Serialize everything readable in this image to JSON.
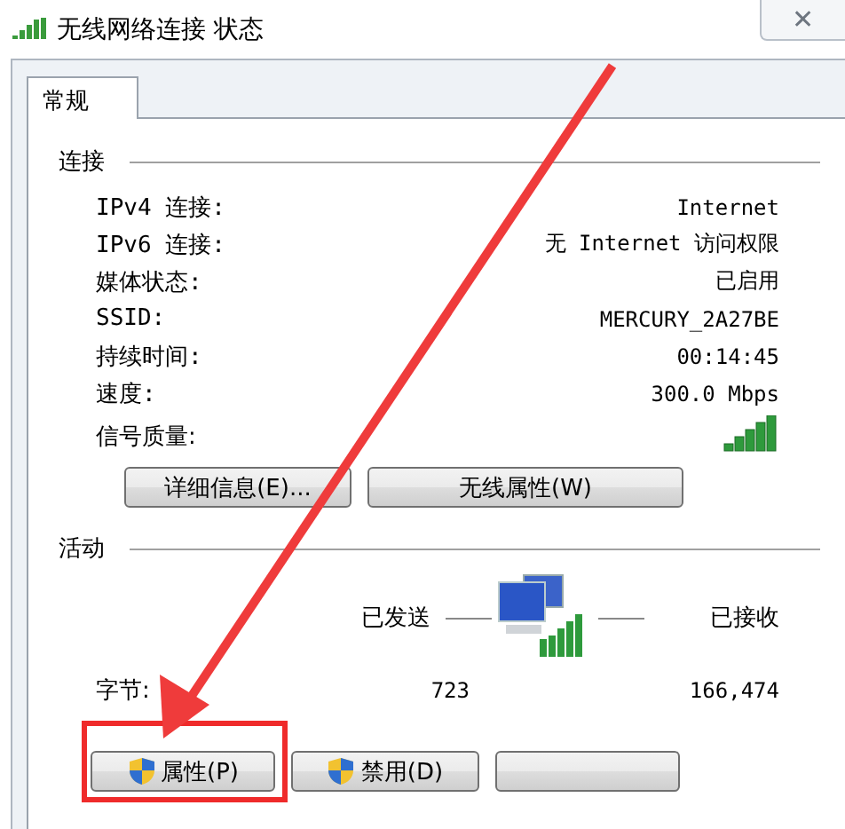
{
  "window": {
    "title": "无线网络连接 状态",
    "close": "✕"
  },
  "tabs": [
    {
      "label": "常规",
      "selected": true
    }
  ],
  "connection": {
    "heading": "连接",
    "rows": [
      {
        "label": "IPv4 连接:",
        "value": "Internet"
      },
      {
        "label": "IPv6 连接:",
        "value": "无 Internet 访问权限"
      },
      {
        "label": "媒体状态:",
        "value": "已启用"
      },
      {
        "label": "SSID:",
        "value": "MERCURY_2A27BE"
      },
      {
        "label": "持续时间:",
        "value": "00:14:45"
      },
      {
        "label": "速度:",
        "value": "300.0 Mbps"
      }
    ],
    "signal_label": "信号质量:",
    "buttons": [
      {
        "label": "详细信息(E)..."
      },
      {
        "label": "无线属性(W)"
      }
    ]
  },
  "activity": {
    "heading": "活动",
    "sent": "已发送",
    "received": "已接收",
    "bytes_label": "字节:",
    "bytes_sent": "723",
    "bytes_received": "166,474"
  },
  "buttons": [
    {
      "label": "属性(P)",
      "shield": true,
      "highlighted": true
    },
    {
      "label": "禁用(D)",
      "shield": true,
      "highlighted": false
    },
    {
      "shield": false,
      "highlighted": false
    }
  ]
}
